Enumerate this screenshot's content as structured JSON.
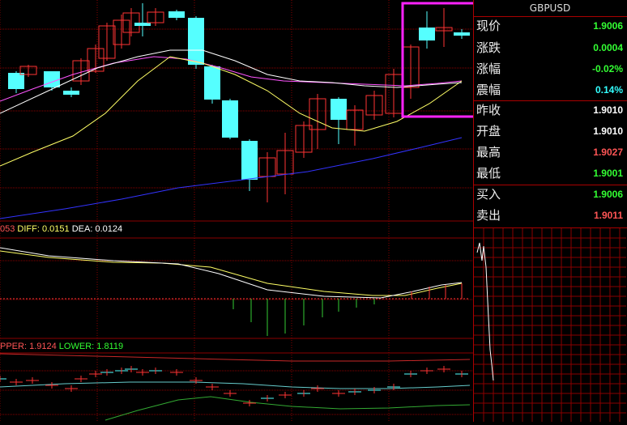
{
  "symbol": "GBPUSD",
  "quote": [
    {
      "label": "现价",
      "value": "1.9006",
      "color": "#33ff33"
    },
    {
      "label": "涨跌",
      "value": "0.0004",
      "color": "#33ff33"
    },
    {
      "label": "涨幅",
      "value": "-0.02%",
      "color": "#33ff33"
    },
    {
      "label": "震幅",
      "value": "0.14%",
      "color": "#33ffff"
    },
    {
      "label": "昨收",
      "value": "1.9010",
      "color": "#ffffff"
    },
    {
      "label": "开盘",
      "value": "1.9010",
      "color": "#ffffff"
    },
    {
      "label": "最高",
      "value": "1.9027",
      "color": "#ff5555"
    },
    {
      "label": "最低",
      "value": "1.9001",
      "color": "#33ff33"
    },
    {
      "label": "买入",
      "value": "1.9006",
      "color": "#33ff33"
    },
    {
      "label": "卖出",
      "value": "1.9011",
      "color": "#ff5555"
    }
  ],
  "macd": {
    "prefix": "053",
    "diff_label": "DIFF:",
    "diff_value": "0.0151",
    "dea_label": "DEA:",
    "dea_value": "0.0124"
  },
  "boll": {
    "upper_label": "PPER:",
    "upper_value": "1.9124",
    "lower_label": "LOWER:",
    "lower_value": "1.8119"
  },
  "colors": {
    "grid": "#8a0000",
    "bull": "#ff3333",
    "bear": "#55ffff",
    "ma_white": "#ffffff",
    "ma_yellow": "#ffff66",
    "ma_magenta": "#ff55ff",
    "ma_blue": "#3333ff",
    "highlight": "#ff22ff"
  }
}
